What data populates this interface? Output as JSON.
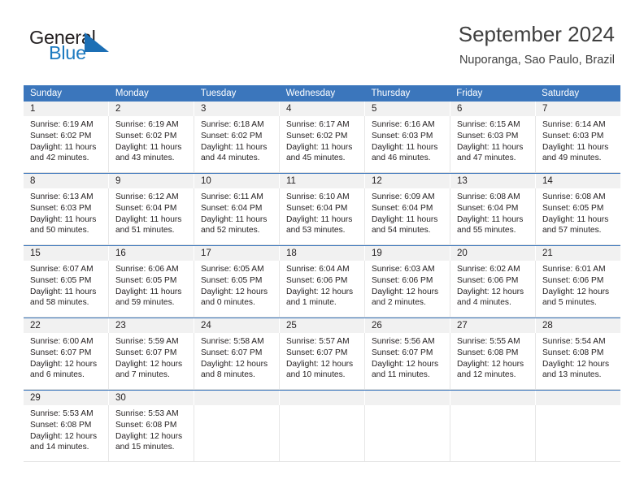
{
  "brand": {
    "name_top": "General",
    "name_bottom": "Blue",
    "triangle_icon": "blue-triangle-logo-mark",
    "accent_color": "#1c7ac0"
  },
  "header": {
    "title": "September 2024",
    "subtitle": "Nuporanga, Sao Paulo, Brazil"
  },
  "theme": {
    "header_blue": "#3b76bc",
    "daynum_band": "#f1f1f1",
    "text": "#231f20"
  },
  "calendar": {
    "weekday_headers": [
      "Sunday",
      "Monday",
      "Tuesday",
      "Wednesday",
      "Thursday",
      "Friday",
      "Saturday"
    ],
    "weeks": [
      {
        "days": [
          {
            "num": "1",
            "lines": [
              "Sunrise: 6:19 AM",
              "Sunset: 6:02 PM",
              "Daylight: 11 hours",
              "and 42 minutes."
            ]
          },
          {
            "num": "2",
            "lines": [
              "Sunrise: 6:19 AM",
              "Sunset: 6:02 PM",
              "Daylight: 11 hours",
              "and 43 minutes."
            ]
          },
          {
            "num": "3",
            "lines": [
              "Sunrise: 6:18 AM",
              "Sunset: 6:02 PM",
              "Daylight: 11 hours",
              "and 44 minutes."
            ]
          },
          {
            "num": "4",
            "lines": [
              "Sunrise: 6:17 AM",
              "Sunset: 6:02 PM",
              "Daylight: 11 hours",
              "and 45 minutes."
            ]
          },
          {
            "num": "5",
            "lines": [
              "Sunrise: 6:16 AM",
              "Sunset: 6:03 PM",
              "Daylight: 11 hours",
              "and 46 minutes."
            ]
          },
          {
            "num": "6",
            "lines": [
              "Sunrise: 6:15 AM",
              "Sunset: 6:03 PM",
              "Daylight: 11 hours",
              "and 47 minutes."
            ]
          },
          {
            "num": "7",
            "lines": [
              "Sunrise: 6:14 AM",
              "Sunset: 6:03 PM",
              "Daylight: 11 hours",
              "and 49 minutes."
            ]
          }
        ]
      },
      {
        "days": [
          {
            "num": "8",
            "lines": [
              "Sunrise: 6:13 AM",
              "Sunset: 6:03 PM",
              "Daylight: 11 hours",
              "and 50 minutes."
            ]
          },
          {
            "num": "9",
            "lines": [
              "Sunrise: 6:12 AM",
              "Sunset: 6:04 PM",
              "Daylight: 11 hours",
              "and 51 minutes."
            ]
          },
          {
            "num": "10",
            "lines": [
              "Sunrise: 6:11 AM",
              "Sunset: 6:04 PM",
              "Daylight: 11 hours",
              "and 52 minutes."
            ]
          },
          {
            "num": "11",
            "lines": [
              "Sunrise: 6:10 AM",
              "Sunset: 6:04 PM",
              "Daylight: 11 hours",
              "and 53 minutes."
            ]
          },
          {
            "num": "12",
            "lines": [
              "Sunrise: 6:09 AM",
              "Sunset: 6:04 PM",
              "Daylight: 11 hours",
              "and 54 minutes."
            ]
          },
          {
            "num": "13",
            "lines": [
              "Sunrise: 6:08 AM",
              "Sunset: 6:04 PM",
              "Daylight: 11 hours",
              "and 55 minutes."
            ]
          },
          {
            "num": "14",
            "lines": [
              "Sunrise: 6:08 AM",
              "Sunset: 6:05 PM",
              "Daylight: 11 hours",
              "and 57 minutes."
            ]
          }
        ]
      },
      {
        "days": [
          {
            "num": "15",
            "lines": [
              "Sunrise: 6:07 AM",
              "Sunset: 6:05 PM",
              "Daylight: 11 hours",
              "and 58 minutes."
            ]
          },
          {
            "num": "16",
            "lines": [
              "Sunrise: 6:06 AM",
              "Sunset: 6:05 PM",
              "Daylight: 11 hours",
              "and 59 minutes."
            ]
          },
          {
            "num": "17",
            "lines": [
              "Sunrise: 6:05 AM",
              "Sunset: 6:05 PM",
              "Daylight: 12 hours",
              "and 0 minutes."
            ]
          },
          {
            "num": "18",
            "lines": [
              "Sunrise: 6:04 AM",
              "Sunset: 6:06 PM",
              "Daylight: 12 hours",
              "and 1 minute."
            ]
          },
          {
            "num": "19",
            "lines": [
              "Sunrise: 6:03 AM",
              "Sunset: 6:06 PM",
              "Daylight: 12 hours",
              "and 2 minutes."
            ]
          },
          {
            "num": "20",
            "lines": [
              "Sunrise: 6:02 AM",
              "Sunset: 6:06 PM",
              "Daylight: 12 hours",
              "and 4 minutes."
            ]
          },
          {
            "num": "21",
            "lines": [
              "Sunrise: 6:01 AM",
              "Sunset: 6:06 PM",
              "Daylight: 12 hours",
              "and 5 minutes."
            ]
          }
        ]
      },
      {
        "days": [
          {
            "num": "22",
            "lines": [
              "Sunrise: 6:00 AM",
              "Sunset: 6:07 PM",
              "Daylight: 12 hours",
              "and 6 minutes."
            ]
          },
          {
            "num": "23",
            "lines": [
              "Sunrise: 5:59 AM",
              "Sunset: 6:07 PM",
              "Daylight: 12 hours",
              "and 7 minutes."
            ]
          },
          {
            "num": "24",
            "lines": [
              "Sunrise: 5:58 AM",
              "Sunset: 6:07 PM",
              "Daylight: 12 hours",
              "and 8 minutes."
            ]
          },
          {
            "num": "25",
            "lines": [
              "Sunrise: 5:57 AM",
              "Sunset: 6:07 PM",
              "Daylight: 12 hours",
              "and 10 minutes."
            ]
          },
          {
            "num": "26",
            "lines": [
              "Sunrise: 5:56 AM",
              "Sunset: 6:07 PM",
              "Daylight: 12 hours",
              "and 11 minutes."
            ]
          },
          {
            "num": "27",
            "lines": [
              "Sunrise: 5:55 AM",
              "Sunset: 6:08 PM",
              "Daylight: 12 hours",
              "and 12 minutes."
            ]
          },
          {
            "num": "28",
            "lines": [
              "Sunrise: 5:54 AM",
              "Sunset: 6:08 PM",
              "Daylight: 12 hours",
              "and 13 minutes."
            ]
          }
        ]
      },
      {
        "days": [
          {
            "num": "29",
            "lines": [
              "Sunrise: 5:53 AM",
              "Sunset: 6:08 PM",
              "Daylight: 12 hours",
              "and 14 minutes."
            ]
          },
          {
            "num": "30",
            "lines": [
              "Sunrise: 5:53 AM",
              "Sunset: 6:08 PM",
              "Daylight: 12 hours",
              "and 15 minutes."
            ]
          },
          {
            "num": "",
            "lines": []
          },
          {
            "num": "",
            "lines": []
          },
          {
            "num": "",
            "lines": []
          },
          {
            "num": "",
            "lines": []
          },
          {
            "num": "",
            "lines": []
          }
        ]
      }
    ]
  }
}
